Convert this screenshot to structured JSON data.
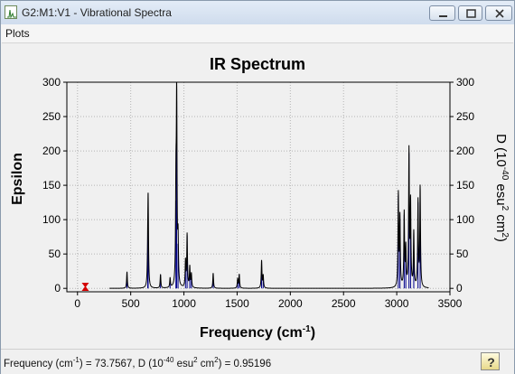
{
  "window": {
    "title": "G2:M1:V1 - Vibrational Spectra"
  },
  "menu": {
    "items": [
      {
        "label": "Plots"
      }
    ]
  },
  "status": {
    "frequency_label": "Frequency (cm",
    "frequency_exp": "-1",
    "mid_text": ") = 73.7567, D (10",
    "d_exp": "-40",
    "unit_text": " esu",
    "unit_exp": "2",
    "unit_text2": " cm",
    "unit_exp2": "2",
    "value_text": ") = 0.95196"
  },
  "chart_data": {
    "type": "line",
    "title": "IR Spectrum",
    "xlabel": "Frequency (cm-1)",
    "xlabel_base": "Frequency (cm",
    "xlabel_exp": "-1",
    "xlabel_close": ")",
    "ylabel_left": "Epsilon",
    "ylabel_right_parts": [
      "D (10",
      "-40",
      " esu",
      "2",
      " cm",
      "2",
      ")"
    ],
    "xlim": [
      -100,
      3500
    ],
    "ylim": [
      -5,
      300
    ],
    "x_ticks": [
      0,
      500,
      1000,
      1500,
      2000,
      2500,
      3000,
      3500
    ],
    "y_ticks": [
      0,
      50,
      100,
      150,
      200,
      250,
      300
    ],
    "grid": true,
    "spectrum_color": "#000000",
    "stick_color": "#00008b",
    "marker_color": "#d40000",
    "marker": {
      "x": 73.7567,
      "y": 0.95196
    },
    "peak_width": 4,
    "peaks": [
      {
        "x": 465,
        "y": 24
      },
      {
        "x": 664,
        "y": 119
      },
      {
        "x": 660,
        "y": 40
      },
      {
        "x": 780,
        "y": 20
      },
      {
        "x": 870,
        "y": 14
      },
      {
        "x": 925,
        "y": 128
      },
      {
        "x": 932,
        "y": 273
      },
      {
        "x": 945,
        "y": 65
      },
      {
        "x": 1015,
        "y": 38
      },
      {
        "x": 1030,
        "y": 77
      },
      {
        "x": 1055,
        "y": 30
      },
      {
        "x": 1070,
        "y": 20
      },
      {
        "x": 1275,
        "y": 22
      },
      {
        "x": 1505,
        "y": 14
      },
      {
        "x": 1520,
        "y": 20
      },
      {
        "x": 1730,
        "y": 40
      },
      {
        "x": 1745,
        "y": 18
      },
      {
        "x": 3015,
        "y": 135
      },
      {
        "x": 3030,
        "y": 100
      },
      {
        "x": 3070,
        "y": 107
      },
      {
        "x": 3085,
        "y": 55
      },
      {
        "x": 3115,
        "y": 197
      },
      {
        "x": 3130,
        "y": 120
      },
      {
        "x": 3160,
        "y": 80
      },
      {
        "x": 3200,
        "y": 125
      },
      {
        "x": 3220,
        "y": 145
      }
    ]
  }
}
